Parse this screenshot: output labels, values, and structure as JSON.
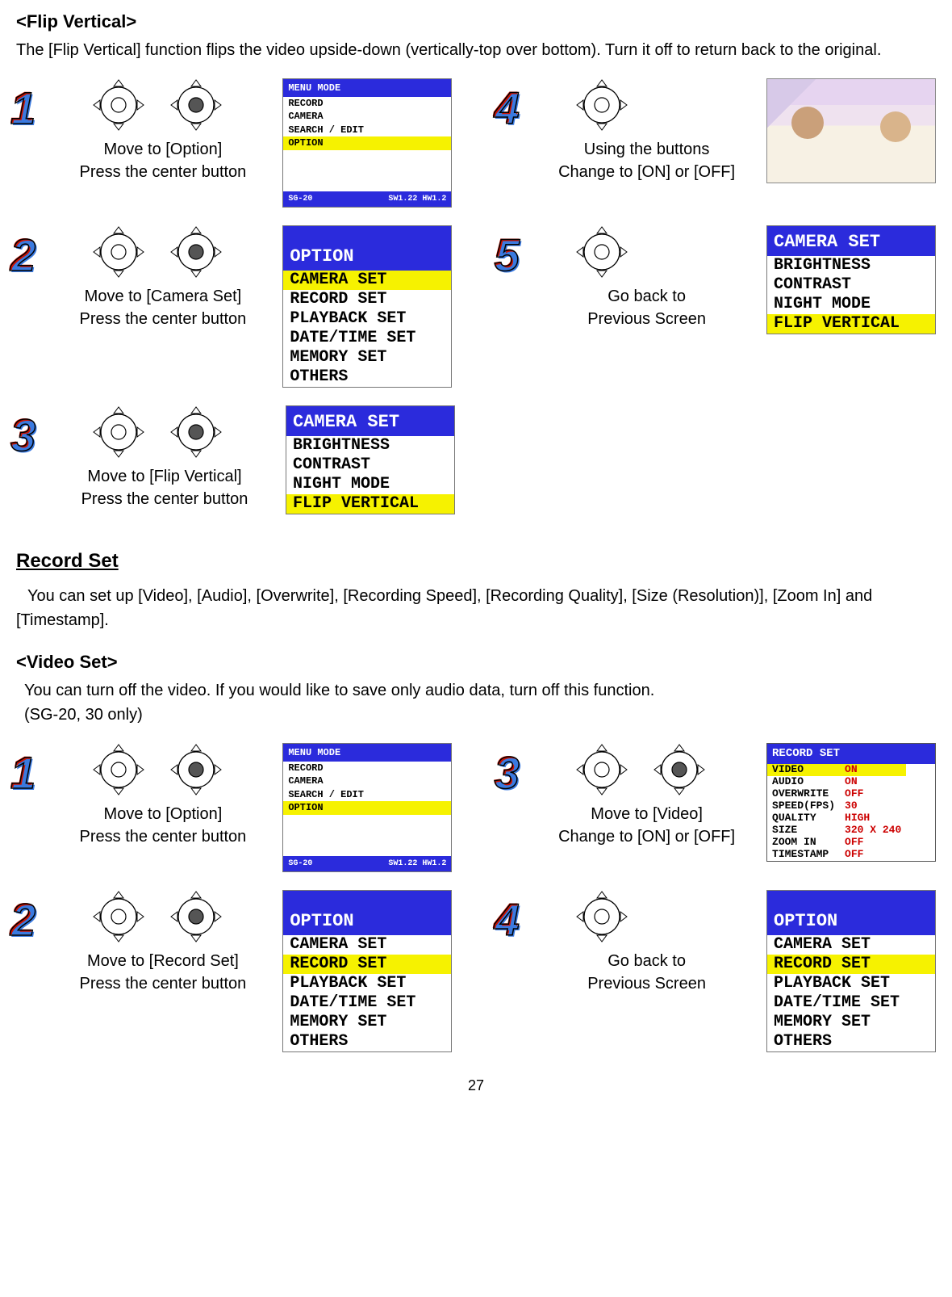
{
  "flip": {
    "heading": "<Flip Vertical>",
    "intro": "The [Flip Vertical] function flips the video upside-down (vertically-top over bottom). Turn it off to return back to the original.",
    "steps": {
      "s1": {
        "num": "1",
        "line1": "Move to [Option]",
        "line2": "Press the center button"
      },
      "s2": {
        "num": "2",
        "line1": "Move to [Camera Set]",
        "line2": "Press the center button"
      },
      "s3": {
        "num": "3",
        "line1": "Move to [Flip Vertical]",
        "line2": "Press the center button"
      },
      "s4": {
        "num": "4",
        "line1": "Using the buttons",
        "line2": "Change to [ON] or [OFF]"
      },
      "s5": {
        "num": "5",
        "line1": "Go back to",
        "line2": "Previous Screen"
      }
    }
  },
  "menu_screen": {
    "title": "MENU MODE",
    "items": [
      "RECORD",
      "CAMERA",
      "SEARCH / EDIT"
    ],
    "highlighted": "OPTION",
    "footer_left": "SG-20",
    "footer_right": "SW1.22 HW1.2"
  },
  "option_screen": {
    "title": "OPTION",
    "items": [
      "CAMERA SET",
      "RECORD SET",
      "PLAYBACK SET",
      "DATE/TIME SET",
      "MEMORY SET",
      "OTHERS"
    ],
    "hl_camera": "CAMERA SET",
    "hl_record": "RECORD SET"
  },
  "camera_screen": {
    "title": "CAMERA SET",
    "items": [
      "BRIGHTNESS",
      "CONTRAST",
      "NIGHT MODE",
      "FLIP VERTICAL"
    ],
    "highlighted": "FLIP VERTICAL"
  },
  "record_set_section": {
    "heading": "Record Set",
    "intro": "You can set up [Video], [Audio], [Overwrite], [Recording Speed], [Recording Quality], [Size (Resolution)], [Zoom In] and [Timestamp]."
  },
  "video_set": {
    "heading": "<Video Set>",
    "line1": "You can turn off the video. If you would like to save only audio data, turn off this function.",
    "line2": "(SG-20, 30 only)",
    "steps": {
      "s1": {
        "num": "1",
        "line1": "Move to [Option]",
        "line2": "Press the center button"
      },
      "s2": {
        "num": "2",
        "line1": "Move to [Record Set]",
        "line2": "Press the center button"
      },
      "s3": {
        "num": "3",
        "line1": "Move to [Video]",
        "line2": "Change to [ON] or [OFF]"
      },
      "s4": {
        "num": "4",
        "line1": "Go back to",
        "line2": "Previous Screen"
      }
    }
  },
  "record_screen": {
    "title": "RECORD SET",
    "rows": [
      {
        "k": "VIDEO",
        "v": "ON",
        "hl": true
      },
      {
        "k": "AUDIO",
        "v": "ON"
      },
      {
        "k": "OVERWRITE",
        "v": "OFF"
      },
      {
        "k": "SPEED(FPS)",
        "v": "30"
      },
      {
        "k": "QUALITY",
        "v": "HIGH"
      },
      {
        "k": "SIZE",
        "v": "320 X 240"
      },
      {
        "k": "ZOOM IN",
        "v": "OFF"
      },
      {
        "k": "TIMESTAMP",
        "v": "OFF"
      }
    ]
  },
  "page_number": "27"
}
